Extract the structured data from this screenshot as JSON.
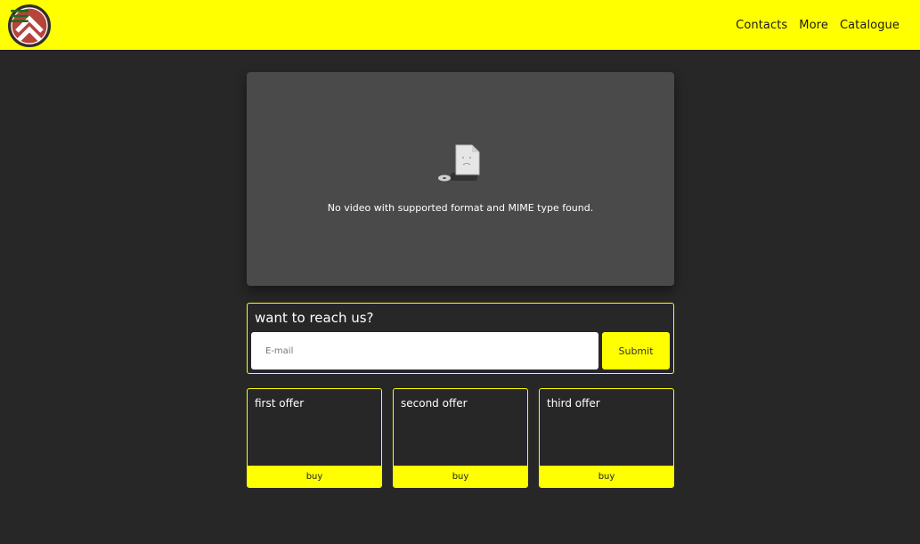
{
  "header": {
    "logo_icon": "chevron-roundel-logo-icon",
    "menu_icon": "hamburger-menu-icon",
    "nav": [
      "Contacts",
      "More",
      "Catalogue"
    ]
  },
  "video": {
    "message": "No video with supported format and MIME type found.",
    "icon": "broken-video-file-icon"
  },
  "contact": {
    "title": "want to reach us?",
    "email_placeholder": "E-mail",
    "email_value": "",
    "submit_label": "Submit"
  },
  "offers": [
    {
      "title": "first offer",
      "button": "buy"
    },
    {
      "title": "second offer",
      "button": "buy"
    },
    {
      "title": "third offer",
      "button": "buy"
    }
  ],
  "colors": {
    "accent": "#ffff00",
    "background": "#272727",
    "video_background": "#4a4a4a",
    "logo_red": "#b5443a",
    "logo_ring": "#2f2f2f",
    "menu_green": "#1f6b1f"
  }
}
